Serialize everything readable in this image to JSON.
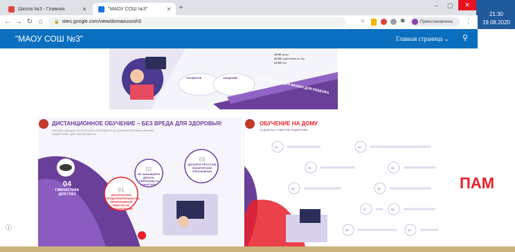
{
  "browser": {
    "tabs": [
      {
        "title": "Школа №3 - Главная",
        "active": false
      },
      {
        "title": "\"МАОУ СОШ №3\"",
        "active": true
      }
    ],
    "new_tab_symbol": "+",
    "url": "sites.google.com/view/domaousosh3",
    "paused_label": "Приостановлена",
    "window_controls": {
      "minimize": "–",
      "maximize": "▢",
      "close": "✕"
    }
  },
  "taskbar": {
    "time": "21:30",
    "date": "19.08.2020"
  },
  "site": {
    "title": "\"МАОУ СОШ №3\"",
    "nav_label": "Главная страница",
    "banner_top": {
      "bubble_1_title": "РАЗВИТИЕ",
      "bubble_2_title": "ОБЩЕНИЕ",
      "schedule_title": "РАСПОРЯДОК ДНЯ ВАЖЕН ДЛЯ РЕБЕНКА",
      "times": [
        "19:00",
        "20:00",
        "21:00"
      ],
      "time_labels": [
        "досуг",
        "подготовка ко сну",
        "сон"
      ]
    },
    "poster_left": {
      "title": "ДИСТАНЦИОННОЕ ОБУЧЕНИЕ – БЕЗ ВРЕДА ДЛЯ ЗДОРОВЬЯ!",
      "subtitle": "РЕКОМЕНДАЦИИ ПО БЕЗОПАСНОЙ РАБОТЕ ЗА КОМПЬЮТЕРОМ И ИНЫМИ ГАДЖЕТАМИ ДЛЯ ШКОЛЬНИКОВ",
      "items": [
        {
          "num": "01",
          "text": "БЕЗОПАСНАЯ ПРОДОЛЖИТЕЛЬНОСТЬ НЕПРЕРЫВНОЙ РАБОТЫ ЗА КОМПЬЮТЕРОМ"
        },
        {
          "num": "02",
          "text": "НЕ ЗАБЫВАЙТЕ ДЕЛАТЬ ПЕРЕРЫВЫ В ЗАНЯТИЯХ"
        },
        {
          "num": "03",
          "text": "ДЕЛАЙТЕ ПРОСТЫЕ ФИЗИЧЕСКИЕ УПРАЖНЕНИЯ"
        },
        {
          "num": "04",
          "text": "ГИМНАСТИКА ДЛЯ ГЛАЗ"
        }
      ]
    },
    "poster_right": {
      "title": "ОБУЧЕНИЕ НА ДОМУ",
      "subtitle": "10 ДОБРЫХ СОВЕТОВ РОДИТЕЛЯМ",
      "numbers": [
        "01",
        "02",
        "03",
        "04",
        "05",
        "06",
        "07",
        "08",
        "09",
        "10"
      ]
    },
    "side_text": "ПАМ"
  },
  "colors": {
    "header": "#0b6fc0",
    "accent_red": "#e8202a",
    "purple": "#6a3f9a"
  }
}
